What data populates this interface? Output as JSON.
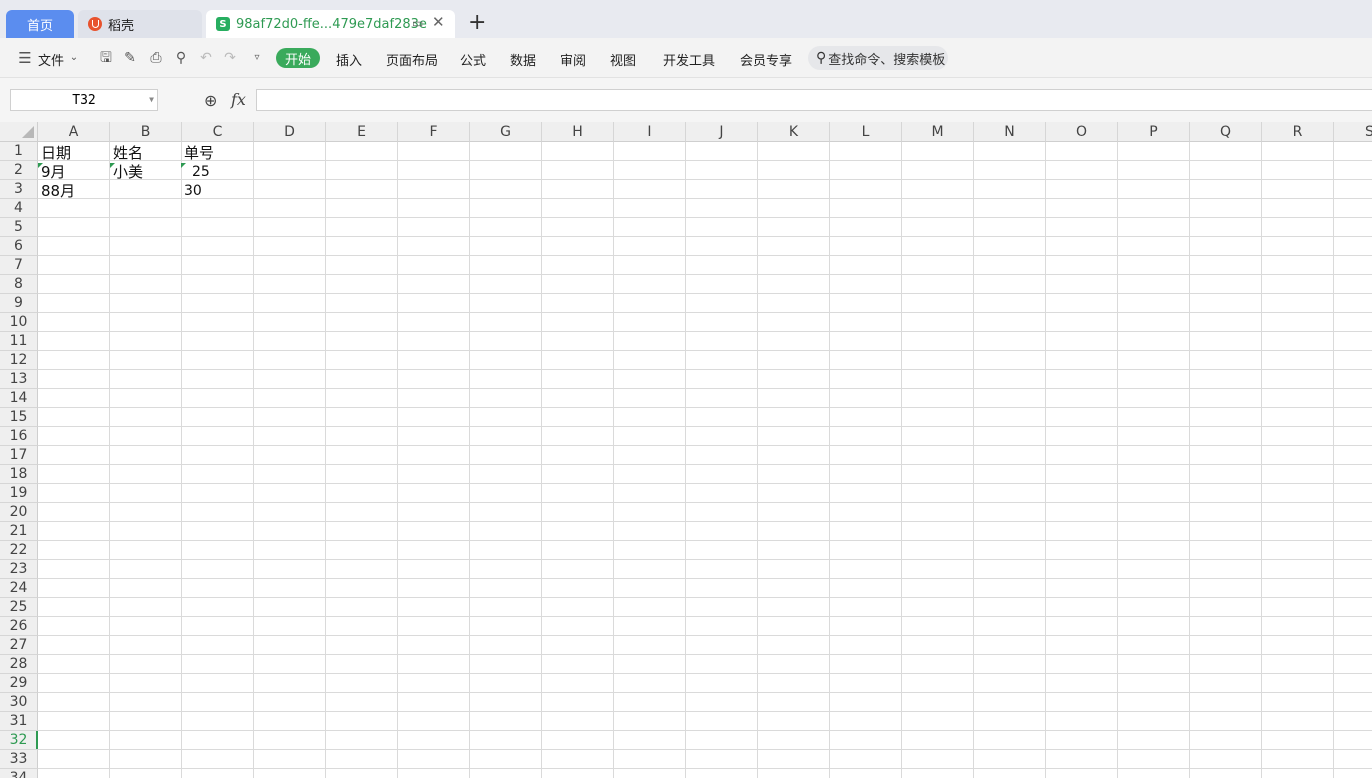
{
  "tabs": {
    "home": "首页",
    "daoke": "稻壳",
    "doc": "98af72d0-ffe...479e7daf283e"
  },
  "menu": {
    "file": "文件",
    "start": "开始",
    "insert": "插入",
    "layout": "页面布局",
    "formula": "公式",
    "data": "数据",
    "review": "审阅",
    "view": "视图",
    "dev": "开发工具",
    "member": "会员专享",
    "search": "查找命令、搜索模板"
  },
  "formula_bar": {
    "name_box": "T32",
    "fx": "fx",
    "content": ""
  },
  "grid": {
    "columns": [
      "A",
      "B",
      "C",
      "D",
      "E",
      "F",
      "G",
      "H",
      "I",
      "J",
      "K",
      "L",
      "M",
      "N",
      "O",
      "P",
      "Q",
      "R",
      "S"
    ],
    "rows": [
      "1",
      "2",
      "3",
      "4",
      "5",
      "6",
      "7",
      "8",
      "9",
      "10",
      "11",
      "12",
      "13",
      "14",
      "15",
      "16",
      "17",
      "18",
      "19",
      "20",
      "21",
      "22",
      "23",
      "24",
      "25",
      "26",
      "27",
      "28",
      "29",
      "30",
      "31",
      "32",
      "33",
      "34"
    ],
    "selected_row": "32",
    "cells": {
      "A1": "日期",
      "B1": "姓名",
      "C1": "单号",
      "A2": "9月",
      "B2": "小美",
      "C2": "25",
      "A3": "88月",
      "C3": "30"
    }
  },
  "colors": {
    "accent_green": "#3aaa5c",
    "home_tab_blue": "#5b8def"
  }
}
